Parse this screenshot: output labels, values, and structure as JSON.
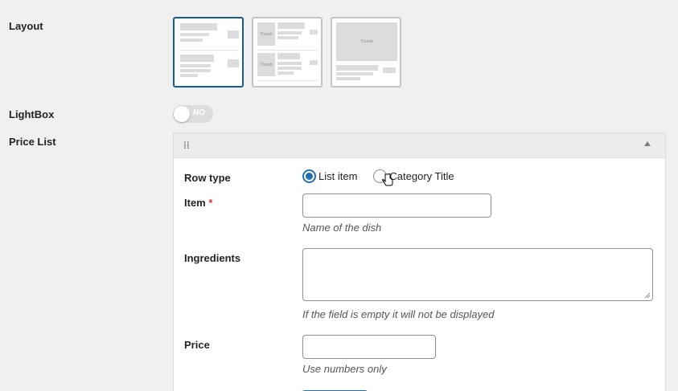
{
  "labels": {
    "layout": "Layout",
    "lightbox": "LightBox",
    "price_list": "Price List"
  },
  "layout_options": [
    {
      "name": "list",
      "selected": true
    },
    {
      "name": "list-with-thumb",
      "thumb_text": "Thumb",
      "selected": false
    },
    {
      "name": "grid-with-thumb",
      "thumb_text": "Thumb",
      "selected": false
    }
  ],
  "lightbox_toggle": {
    "text": "NO",
    "on": false
  },
  "row": {
    "row_type_label": "Row type",
    "options": [
      "List item",
      "Category Title"
    ],
    "selected_option": "List item",
    "item_label": "Item",
    "required_mark": "*",
    "item_value": "",
    "item_hint": "Name of the dish",
    "ingredients_label": "Ingredients",
    "ingredients_value": "",
    "ingredients_hint": "If the field is empty it will not be displayed",
    "price_label": "Price",
    "price_value": "",
    "price_hint": "Use numbers only"
  },
  "colors": {
    "accent": "#2271b1",
    "selected_border": "#135e96",
    "required": "#d63638",
    "toggle_off": "#dcdcde"
  }
}
